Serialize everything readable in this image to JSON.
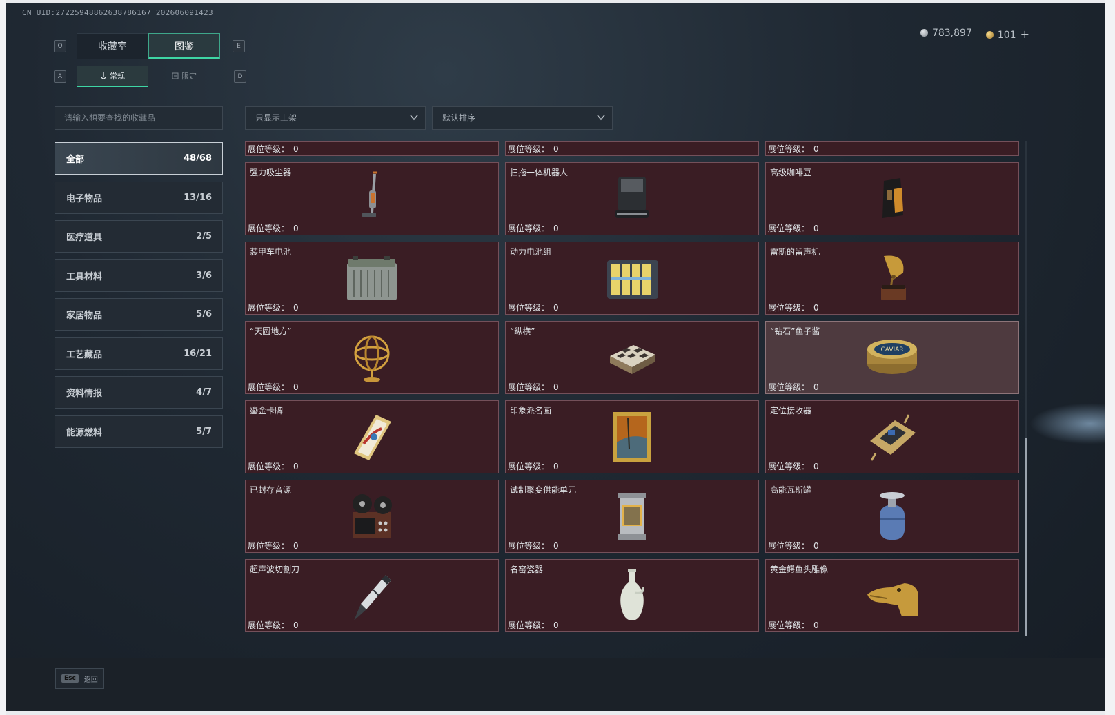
{
  "uid": "CN UID:27225948862638786167_202606091423",
  "currency": {
    "silver": "783,897",
    "gold": "101",
    "plus": "+"
  },
  "keys": {
    "q": "Q",
    "e": "E",
    "a": "A",
    "d": "D"
  },
  "tabs": [
    {
      "label": "收藏室",
      "active": false
    },
    {
      "label": "图鉴",
      "active": true
    }
  ],
  "subtabs": [
    {
      "label": "常规",
      "active": true
    },
    {
      "label": "限定",
      "active": false
    }
  ],
  "search": {
    "placeholder": "请输入想要查找的收藏品"
  },
  "filters": {
    "shelf": "只显示上架",
    "sort": "默认排序"
  },
  "categories": [
    {
      "label": "全部",
      "count": "48/68",
      "active": true
    },
    {
      "label": "电子物品",
      "count": "13/16"
    },
    {
      "label": "医疗道具",
      "count": "2/5"
    },
    {
      "label": "工具材料",
      "count": "3/6"
    },
    {
      "label": "家居物品",
      "count": "5/6"
    },
    {
      "label": "工艺藏品",
      "count": "16/21"
    },
    {
      "label": "资料情报",
      "count": "4/7"
    },
    {
      "label": "能源燃料",
      "count": "5/7"
    }
  ],
  "level_label": "展位等级：",
  "level_value": "0",
  "items": [
    {
      "name": "强力吸尘器",
      "icon": "vacuum-icon"
    },
    {
      "name": "扫拖一体机器人",
      "icon": "robot-mop-icon"
    },
    {
      "name": "高级咖啡豆",
      "icon": "coffee-bag-icon"
    },
    {
      "name": "装甲车电池",
      "icon": "battery-icon"
    },
    {
      "name": "动力电池组",
      "icon": "battery-pack-icon"
    },
    {
      "name": "雷斯的留声机",
      "icon": "gramophone-icon"
    },
    {
      "name": "“天圆地方”",
      "icon": "armillary-icon"
    },
    {
      "name": "“纵横”",
      "icon": "chess-box-icon"
    },
    {
      "name": "“钻石”鱼子酱",
      "icon": "caviar-tin-icon"
    },
    {
      "name": "鎏金卡牌",
      "icon": "gold-card-icon"
    },
    {
      "name": "印象派名画",
      "icon": "painting-icon"
    },
    {
      "name": "定位接收器",
      "icon": "receiver-icon"
    },
    {
      "name": "已封存音源",
      "icon": "reel-recorder-icon"
    },
    {
      "name": "试制聚变供能单元",
      "icon": "fusion-unit-icon"
    },
    {
      "name": "高能瓦斯罐",
      "icon": "gas-tank-icon"
    },
    {
      "name": "超声波切割刀",
      "icon": "ultrasonic-knife-icon"
    },
    {
      "name": "名窑瓷器",
      "icon": "porcelain-vase-icon"
    },
    {
      "name": "黄金鳄鱼头雕像",
      "icon": "croc-head-icon"
    }
  ],
  "caviar_text": "CAVIAR",
  "footer": {
    "key": "Esc",
    "label": "返回"
  }
}
